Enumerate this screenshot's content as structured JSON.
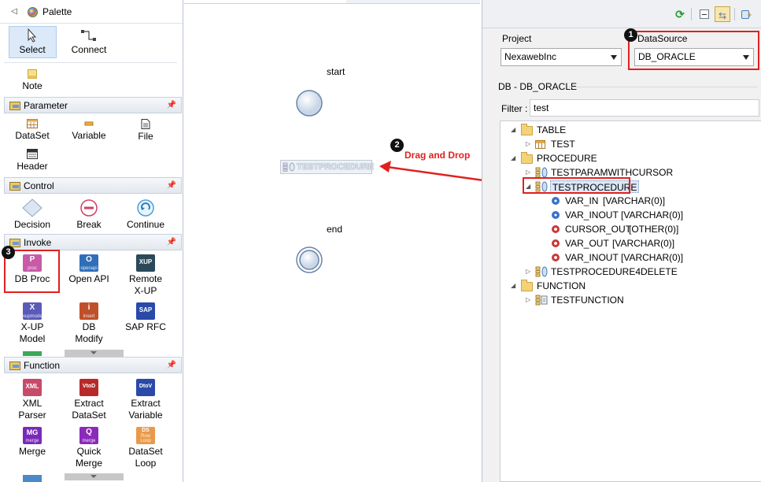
{
  "palette": {
    "title": "Palette",
    "tools": [
      {
        "label": "Select"
      },
      {
        "label": "Connect"
      },
      {
        "label": "Note"
      }
    ],
    "sections": {
      "parameter": {
        "title": "Parameter",
        "items": [
          "DataSet",
          "Variable",
          "File",
          "Header"
        ]
      },
      "control": {
        "title": "Control",
        "items": [
          "Decision",
          "Break",
          "Continue"
        ]
      },
      "invoke": {
        "title": "Invoke",
        "items": [
          "DB Proc",
          "Open API",
          "Remote X-UP",
          "X-UP Model",
          "DB Modify",
          "SAP RFC"
        ]
      },
      "function": {
        "title": "Function",
        "items": [
          "XML Parser",
          "Extract DataSet",
          "Extract Variable",
          "Merge",
          "Quick Merge",
          "DataSet Loop"
        ]
      }
    },
    "icon_text": {
      "dbproc": "P",
      "dbproc_sub": "proc",
      "openapi": "O",
      "openapi_sub": "openapi",
      "xup": "XUP",
      "xupmodel": "X",
      "xupmodel_sub": "xupmodel",
      "dbmodify": "i",
      "dbmodify_sub": "insert",
      "sap": "SAP",
      "xml": "XML",
      "vtod": "VtoD",
      "dtov": "DtoV",
      "mg": "MG",
      "mg_sub": "merge",
      "q": "Q",
      "q_sub": "merge",
      "ds": "DS",
      "ds_sub": "Row Loop"
    }
  },
  "canvas": {
    "start_label": "start",
    "end_label": "end",
    "dropped_node": "TESTPROCEDURE",
    "drag_label": "Drag and Drop"
  },
  "right": {
    "project_label": "Project",
    "project_value": "NexawebInc",
    "datasource_label": "DataSource",
    "datasource_value": "DB_ORACLE",
    "db_label": "DB - DB_ORACLE",
    "filter_label": "Filter :",
    "filter_value": "test",
    "tree": {
      "table_folder": "TABLE",
      "table_item": "TEST",
      "procedure_folder": "PROCEDURE",
      "proc1": "TESTPARAMWITHCURSOR",
      "proc2": "TESTPROCEDURE",
      "params": [
        {
          "name": "VAR_IN",
          "type": "[VARCHAR(0)]",
          "dir": "in"
        },
        {
          "name": "VAR_INOUT",
          "type": "[VARCHAR(0)]",
          "dir": "in"
        },
        {
          "name": "CURSOR_OUT",
          "type": "[OTHER(0)]",
          "dir": "out"
        },
        {
          "name": "VAR_OUT",
          "type": "[VARCHAR(0)]",
          "dir": "out"
        },
        {
          "name": "VAR_INOUT",
          "type": "[VARCHAR(0)]",
          "dir": "out"
        }
      ],
      "proc3": "TESTPROCEDURE4DELETE",
      "function_folder": "FUNCTION",
      "func1": "TESTFUNCTION"
    }
  },
  "annotations": {
    "badge1": "1",
    "badge2": "2",
    "badge3": "3",
    "highlight_color": "#e02020"
  }
}
